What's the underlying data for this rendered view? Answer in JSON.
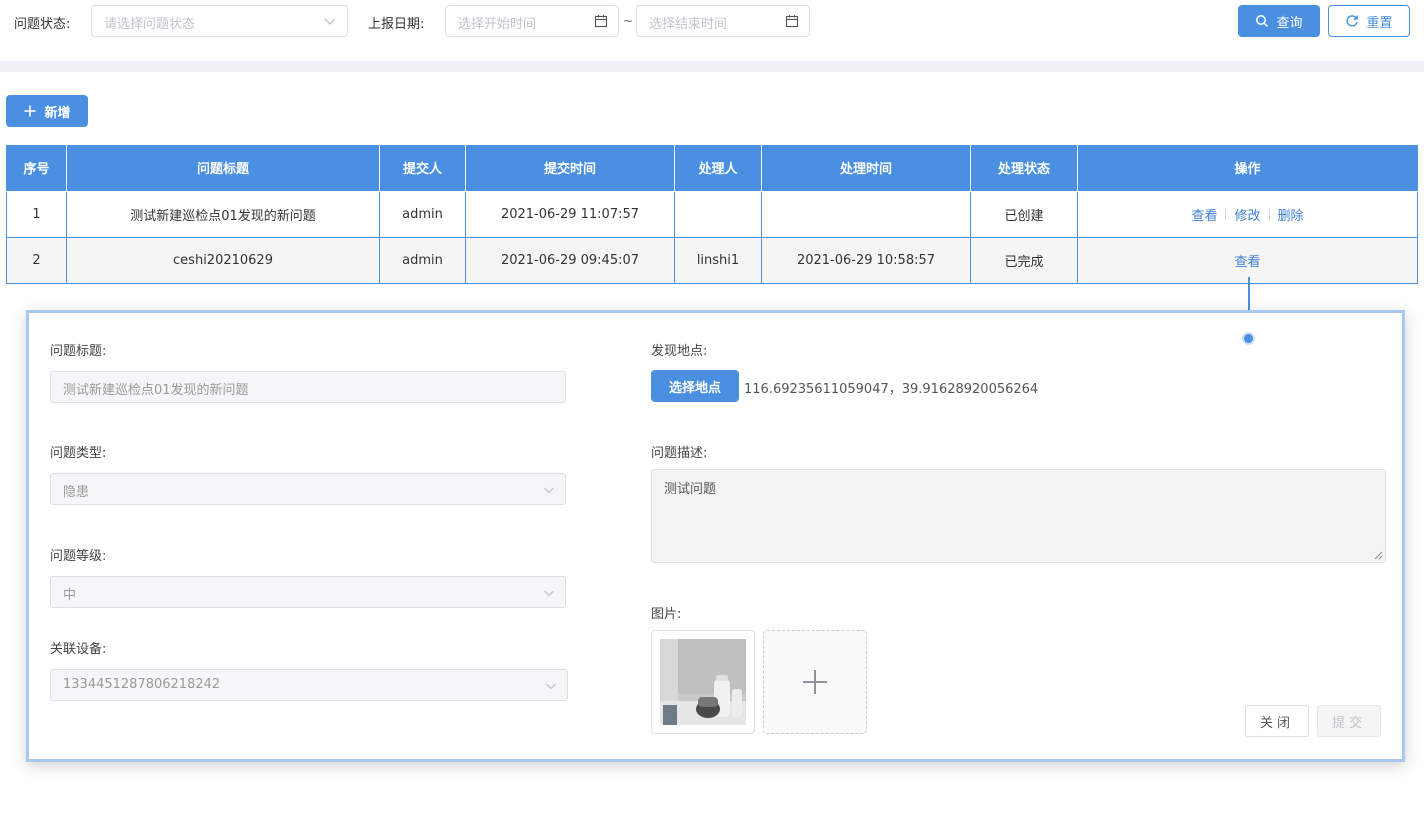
{
  "filters": {
    "status_label": "问题状态:",
    "status_placeholder": "请选择问题状态",
    "date_label": "上报日期:",
    "start_placeholder": "选择开始时间",
    "date_separator": "~",
    "end_placeholder": "选择结束时间",
    "query_label": "查询",
    "reset_label": "重置"
  },
  "toolbar": {
    "add_label": "新增"
  },
  "table": {
    "columns": [
      "序号",
      "问题标题",
      "提交人",
      "提交时间",
      "处理人",
      "处理时间",
      "处理状态",
      "操作"
    ],
    "rows": [
      {
        "index": "1",
        "title": "测试新建巡检点01发现的新问题",
        "submitter": "admin",
        "submit_time": "2021-06-29 11:07:57",
        "handler": "",
        "handle_time": "",
        "status": "已创建",
        "actions": [
          "查看",
          "修改",
          "删除"
        ]
      },
      {
        "index": "2",
        "title": "ceshi20210629",
        "submitter": "admin",
        "submit_time": "2021-06-29 09:45:07",
        "handler": "linshi1",
        "handle_time": "2021-06-29 10:58:57",
        "status": "已完成",
        "actions": [
          "查看"
        ]
      }
    ]
  },
  "form": {
    "title_label": "问题标题:",
    "title_value": "测试新建巡检点01发现的新问题",
    "type_label": "问题类型:",
    "type_value": "隐患",
    "level_label": "问题等级:",
    "level_value": "中",
    "device_label": "关联设备:",
    "device_value": "1334451287806218242",
    "location_label": "发现地点:",
    "select_location_label": "选择地点",
    "coordinates": "116.69235611059047，39.91628920056264",
    "desc_label": "问题描述:",
    "desc_value": "测试问题",
    "image_label": "图片:",
    "close_label": "关闭",
    "submit_label": "提交"
  },
  "colors": {
    "primary": "#4a8fe0",
    "link": "#3f7fd0",
    "panel_border": "#a8c8ef"
  },
  "icons": [
    "chevron-down-icon",
    "calendar-icon",
    "search-icon",
    "refresh-icon",
    "plus-icon",
    "resize-handle-icon"
  ]
}
